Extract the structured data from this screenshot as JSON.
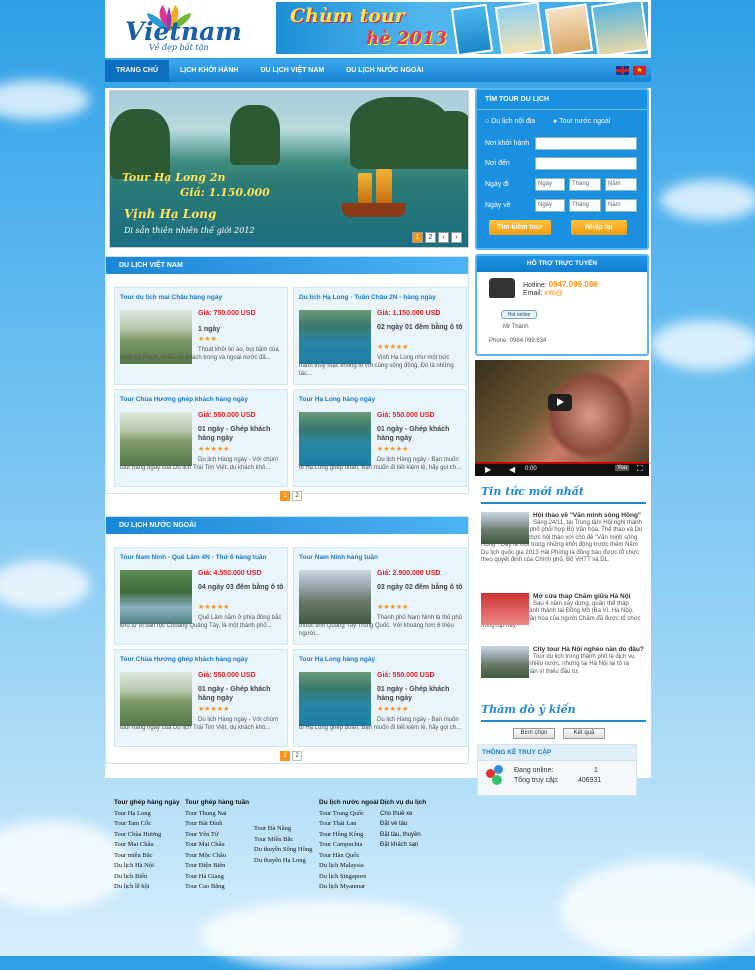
{
  "header": {
    "logo_text": "Vietnam",
    "logo_slogan": "Vẻ đẹp bất tận",
    "banner_line1": "Chùm tour",
    "banner_line2": "hè 2013"
  },
  "nav": {
    "items": [
      "TRANG CHỦ",
      "LỊCH KHỞI HÀNH",
      "DU LỊCH VIỆT NAM",
      "DU LỊCH NƯỚC NGOÀI"
    ]
  },
  "slider": {
    "caption1": "Tour Hạ Long 2n",
    "caption2": "Giá: 1.150.000",
    "caption3": "Vịnh Hạ Long",
    "caption4": "Di sản thiên nhiên thế giới 2012",
    "pages": [
      "1",
      "2"
    ]
  },
  "search": {
    "title": "TÌM TOUR DU LỊCH",
    "radio_domestic": "Du lịch nội địa",
    "radio_foreign": "Tour nước ngoài",
    "label_from": "Nơi khởi hành",
    "label_to": "Nơi đến",
    "label_depart": "Ngày đi",
    "label_return": "Ngày về",
    "sel_day": "Ngày",
    "sel_month": "Tháng",
    "sel_year": "Năm",
    "btn_search": "Tìm kiếm tour",
    "btn_reset": "Nhập lại"
  },
  "support": {
    "title": "HỖ TRỢ TRỰC TUYẾN",
    "hotline_label": "Hotline:",
    "hotline": "0947.099.086",
    "email_label": "Email:",
    "email": "info@",
    "online_badge": "Hot online",
    "name": "Mr Thành",
    "phone": "Phone: 0984.099.634"
  },
  "vn_section": {
    "title": "DU LỊCH VIỆT NAM",
    "pages": [
      "1",
      "2"
    ],
    "tours": [
      {
        "title": "Tour du lịch mai Châu hàng ngày",
        "price": "Giá: 750.000 USD",
        "duration": "1 ngày",
        "stars": "★★★",
        "desc": "Thoát khỏi ồn ào, bụi bặm của chốn thị thành, nhiều du khách trong và ngoài nước đã..."
      },
      {
        "title": "Du lịch Hạ Long - Tuần Châu 2N - hàng ngày",
        "price": "Giá: 1.150.000 USD",
        "duration": "02 ngày 01 đêm bằng ô tô",
        "stars": "★★★★★",
        "desc": "Vịnh Hạ Long như một bức tranh thuỷ mặc khổng lồ với cũng sống động. Đó là những tác..."
      },
      {
        "title": "Tour Chùa Hương ghép khách hàng ngày",
        "price": "Giá: 550.000 USD",
        "duration": "01 ngày - Ghép khách hàng ngày",
        "stars": "★★★★★",
        "desc": "Du lịch Hàng ngày - Với chùm tour hàng ngày của Du lịch Trái Tim Việt, du khách khô..."
      },
      {
        "title": "Tour Hạ Long hàng ngày",
        "price": "Giá: 550.000 USD",
        "duration": "01 ngày - Ghép khách hàng ngày",
        "stars": "★★★★★",
        "desc": "Du lịch Hàng ngày - Bạn muốn đi Hạ Long ghép đoàn, Bạn muốn đi tiết kiệm lẻ, hãy gọi ch..."
      }
    ]
  },
  "foreign_section": {
    "title": "DU LỊCH NƯỚC NGOÀI",
    "pages": [
      "1",
      "2"
    ],
    "tours": [
      {
        "title": "Tour Nam Ninh - Quế Lâm 4N - Thứ 6 hàng tuần",
        "price": "Giá: 4.550.000 USD",
        "duration": "04 ngày 03 đêm bằng ô tô",
        "stars": "★★★★★",
        "desc": "Quế Lâm nằm ở phía đông bắc khu tự trị dân tộc Choang Quảng Tây, là một thành phố..."
      },
      {
        "title": "Tour Nam Ninh hàng tuần",
        "price": "Giá: 2.900.000 USD",
        "duration": "03 ngày 02 đêm bằng ô tô",
        "stars": "★★★★★",
        "desc": "Thành phố Nam Ninh là thủ phủ thuộc tỉnh Quảng Tây Trung Quốc. Với khoảng hơn 6 triệu người..."
      },
      {
        "title": "Tour Chùa Hương ghép khách hàng ngày",
        "price": "Giá: 550.000 USD",
        "duration": "01 ngày - Ghép khách hàng ngày",
        "stars": "★★★★★",
        "desc": "Du lịch Hàng ngày - Với chùm tour hàng ngày của Du lịch Trái Tim Việt, du khách khô..."
      },
      {
        "title": "Tour Hạ Long hàng ngày",
        "price": "Giá: 550.000 USD",
        "duration": "01 ngày - Ghép khách hàng ngày",
        "stars": "★★★★★",
        "desc": "Du lịch Hàng ngày - Bạn muốn đi Hạ Long ghép đoàn, Bạn muốn đi tiết kiệm lẻ, hãy gọi ch..."
      }
    ]
  },
  "news": {
    "title": "Tin tức mới nhất",
    "items": [
      {
        "title": "Hội thảo về \"Văn minh sông Hồng\"",
        "text": "Sáng 24/11, tại Trung tâm Hội nghị thành phố, UBND thành phố phối hợp Bộ Văn hóa, Thể thao và Du lịch (VHTTDL) tổ chức hội thảo với chủ đề \"Văn minh sông Hồng\". Đây là một trong những khởi động trước thềm Năm Du lịch quốc gia 2013 Hải Phòng là đồng báo được tổ chức theo quyết định của Chính phủ, Bộ VHTT và DL."
      },
      {
        "title": "Mở cửa tháp Chăm giữa Hà Nội",
        "text": "Sau 4 năm xây dựng, quần thể tháp Chăm đã được khánh thành tại Đồng Mô (Ba Vì, Hà Nội). Nhiều hoạt động văn hóa của người Chăm đã được tổ chức trong dịp này."
      },
      {
        "title": "City tour Hà Nội nghèo nàn do đâu?",
        "text": "Tour du lịch trong thành phố là dịch vụ hấp dẫn ở thủ đô nhiều nước, nhưng tại Hà Nội lại tỏ ra nghèo nàn, một phần vì thiếu đầu tư."
      }
    ]
  },
  "poll": {
    "title": "Thăm dò ý kiến",
    "btn_vote": "Bình chọn",
    "btn_result": "Kết quả"
  },
  "stats": {
    "title": "THỐNG KÊ TRUY CẬP",
    "online_label": "Đang online:",
    "online_value": "1",
    "total_label": "Tổng truy cập:",
    "total_value": "406931"
  },
  "footer": {
    "cols": [
      {
        "head": "Tour ghép hàng ngày",
        "items": [
          "Tour Hạ Long",
          "Tour Tam Cốc",
          "Tour Chùa Hương",
          "Tour Mai Châu",
          "Tour miền Bắc",
          "Du lịch Hà Nội",
          "Du lịch Biển",
          "Du lịch lễ hội"
        ]
      },
      {
        "head": "Tour ghép hàng tuần",
        "items": [
          "Tour Thung Nai",
          "Tour Bái Đính",
          "Tour Yên Tử",
          "Tour Mai Châu",
          "Tour Mộc Châu",
          "Tour Điện Biên",
          "Tour Hà Giang",
          "Tour Cao Bằng"
        ]
      },
      {
        "head": "",
        "items": [
          "Tour Đà Nẵng",
          "Tour Miền Bắc",
          "Du thuyền Sông Hồng",
          "Du thuyền Hạ Long"
        ]
      },
      {
        "head": "Du lịch nước ngoài",
        "items": [
          "Tour Trung Quốc",
          "Tour Thái Lan",
          "Tour Hồng Kông",
          "Tour Campuchia",
          "Tour Hàn Quốc",
          "Du lịch Malaysia",
          "Du lịch Singapore",
          "Du lịch Myanmar"
        ]
      },
      {
        "head": "Dịch vụ du lịch",
        "items": [
          "Cho thuê xe",
          "Đặt vé tàu",
          "Đặt tàu, thuyền",
          "Đặt khách sạn"
        ]
      }
    ]
  }
}
